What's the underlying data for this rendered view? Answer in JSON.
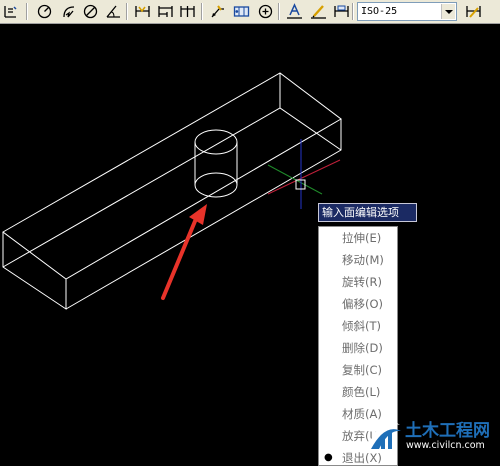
{
  "toolbar": {
    "dim_style_value": "ISO-25",
    "icons": [
      "dim-ordinate-icon",
      "dim-radius-icon",
      "dim-jogged-icon",
      "dim-diameter-icon",
      "dim-angular-icon",
      "quick-dim-icon",
      "dim-baseline-icon",
      "dim-continue-icon",
      "quick-leader-icon",
      "tolerance-icon",
      "center-mark-icon",
      "dim-edit-icon",
      "dim-text-edit-icon",
      "dim-update-icon",
      "dim-style-manager-icon"
    ]
  },
  "tooltip": {
    "text": "输入面编辑选项"
  },
  "context_menu": {
    "items": [
      {
        "label": "拉伸(E)"
      },
      {
        "label": "移动(M)"
      },
      {
        "label": "旋转(R)"
      },
      {
        "label": "偏移(O)"
      },
      {
        "label": "倾斜(T)"
      },
      {
        "label": "删除(D)"
      },
      {
        "label": "复制(C)"
      },
      {
        "label": "颜色(L)"
      },
      {
        "label": "材质(A)"
      },
      {
        "label": "放弃(U)"
      },
      {
        "label": "退出(X)",
        "bullet": "●"
      }
    ]
  },
  "watermark": {
    "title": "土木工程网",
    "url": "www.civilcn.com"
  },
  "colors": {
    "canvas_bg": "#000000",
    "wireframe": "#ffffff",
    "arrow": "#e8332a",
    "ucs_x": "#c0203a",
    "ucs_y": "#1f8a2a",
    "ucs_z": "#2433c8",
    "tooltip_bg": "#1b2a63",
    "watermark_blue": "#1f6fb8"
  }
}
